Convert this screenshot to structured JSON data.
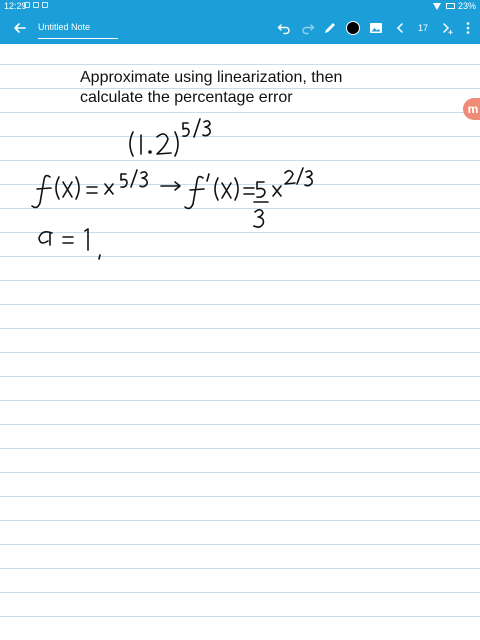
{
  "status_bar": {
    "time": "12:29",
    "battery": "23%"
  },
  "app_bar": {
    "title": "Untitled Note",
    "page_number": "17",
    "pen_color": "#000000",
    "accent": "#1c9fd8"
  },
  "note": {
    "heading_line1": "Approximate using linearization, then",
    "heading_line2": "calculate the percentage error",
    "handwriting": [
      "(1.2)^(5/3)",
      "f(x) = x^(5/3) → f'(x) = (5/3) x^(2/3)",
      "a = 1,"
    ]
  },
  "side_badge": {
    "label": "m"
  }
}
